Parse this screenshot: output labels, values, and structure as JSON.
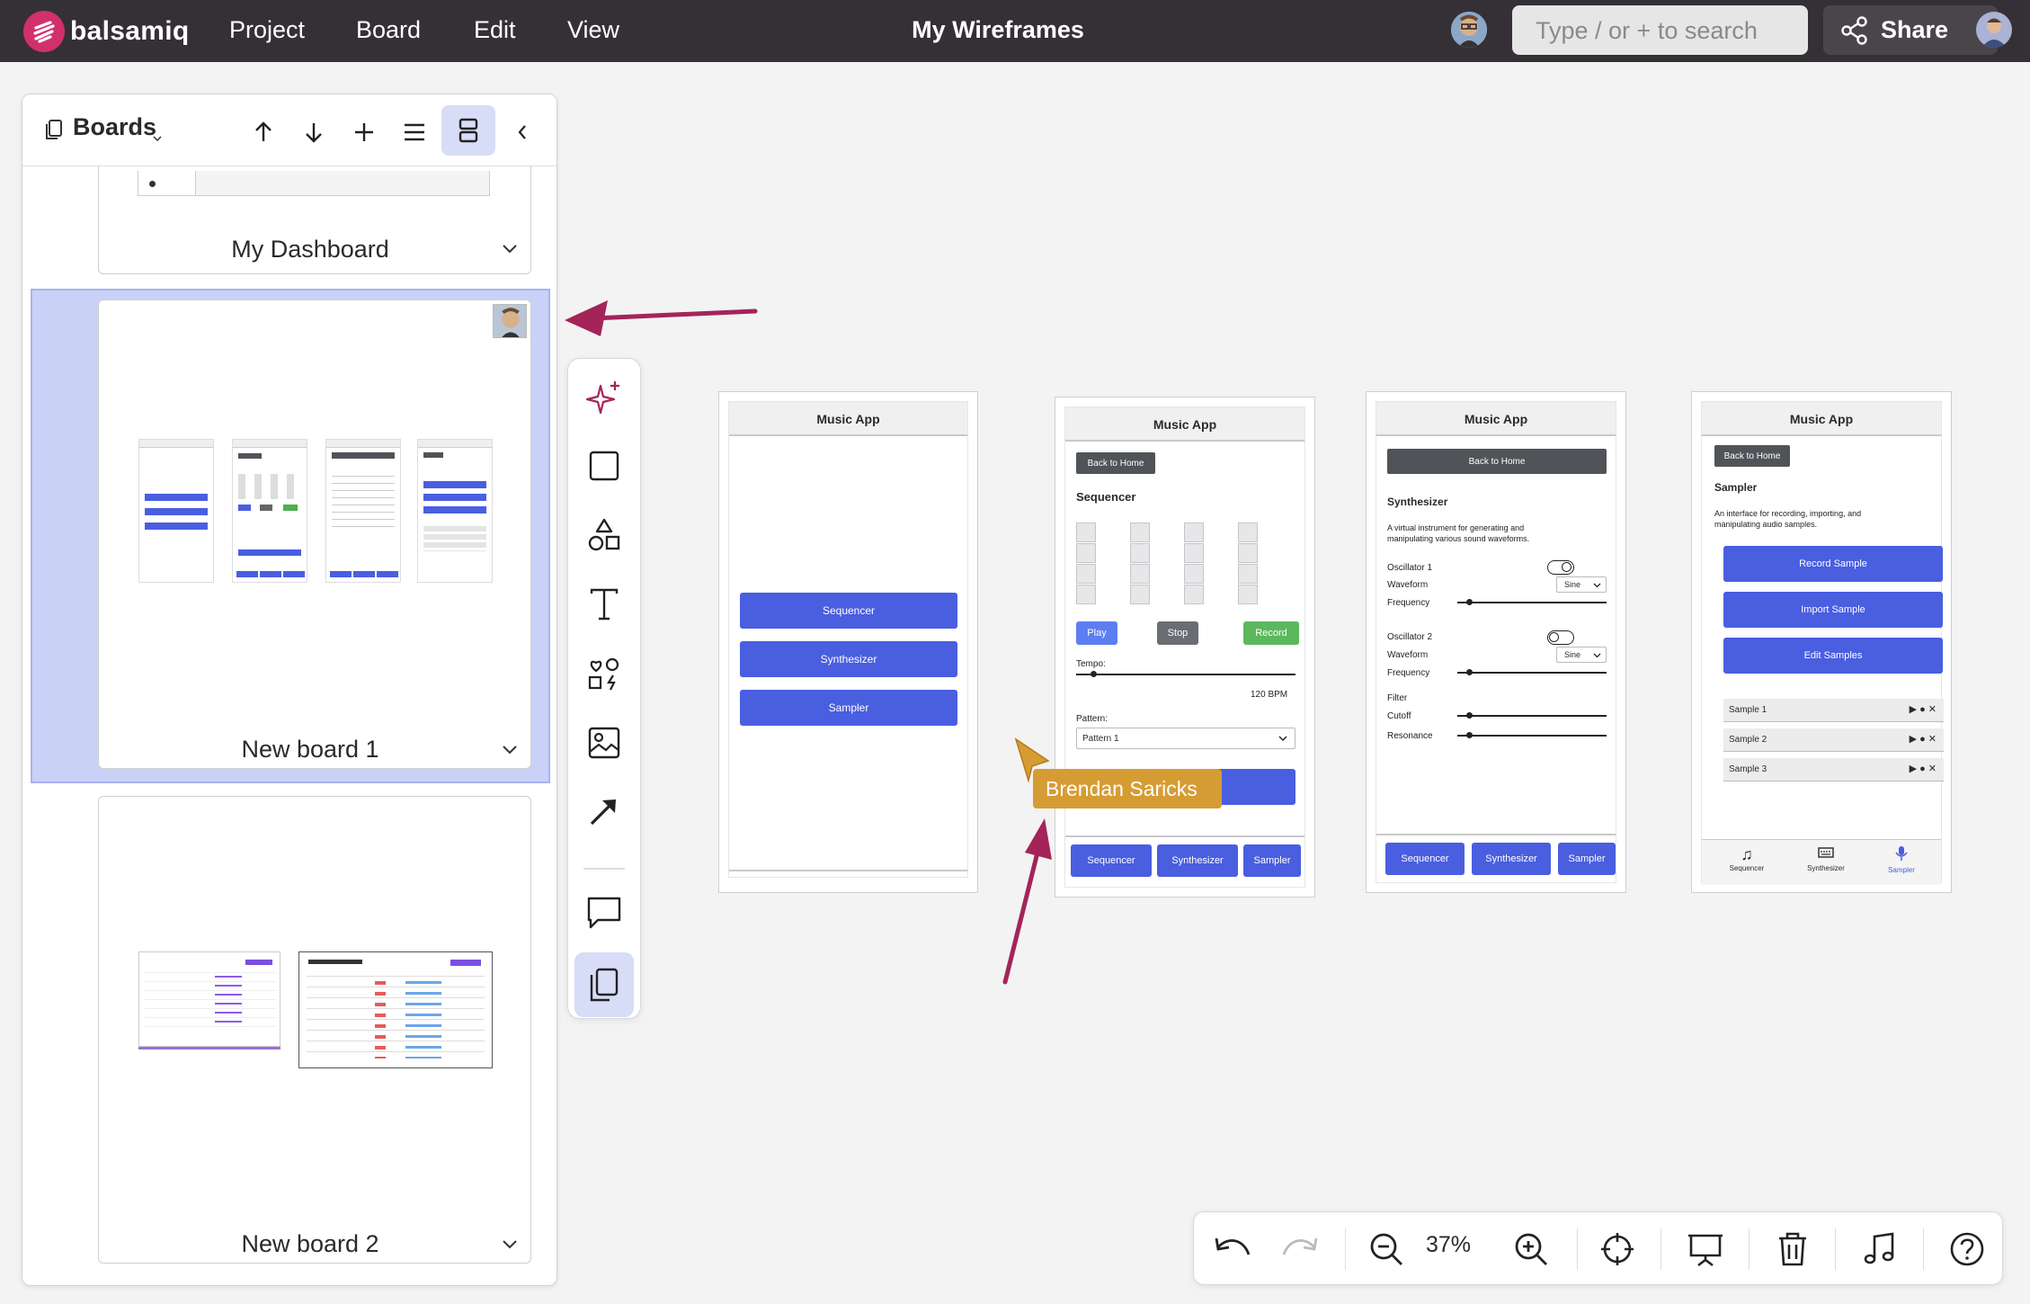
{
  "app": {
    "logo_text": "balsamiq",
    "title": "My Wireframes",
    "menu": [
      "Project",
      "Board",
      "Edit",
      "View"
    ],
    "search_placeholder": "Type / or + to search",
    "share_label": "Share"
  },
  "boards_panel": {
    "title": "Boards",
    "boards": [
      {
        "name": "My Dashboard"
      },
      {
        "name": "New board 1",
        "selected": true
      },
      {
        "name": "New board 2"
      }
    ]
  },
  "toolbar": {
    "tools": [
      "sparkle-icon",
      "rectangle-icon",
      "shapes-icon",
      "text-icon",
      "icons-icon",
      "image-icon",
      "arrow-icon",
      "comment-icon",
      "boards-icon"
    ]
  },
  "wireframes": {
    "home": {
      "title": "Music App",
      "buttons": [
        "Sequencer",
        "Synthesizer",
        "Sampler"
      ]
    },
    "sequencer": {
      "title": "Music App",
      "back": "Back to Home",
      "heading": "Sequencer",
      "play": "Play",
      "stop": "Stop",
      "record": "Record",
      "tempo_label": "Tempo:",
      "tempo_value": "120 BPM",
      "pattern_label": "Pattern:",
      "pattern_value": "Pattern 1",
      "tabs": [
        "Sequencer",
        "Synthesizer",
        "Sampler"
      ]
    },
    "synthesizer": {
      "title": "Music App",
      "back": "Back to Home",
      "heading": "Synthesizer",
      "description": "A virtual instrument for generating and manipulating various sound waveforms.",
      "osc1": "Oscillator 1",
      "osc2": "Oscillator 2",
      "waveform": "Waveform",
      "frequency": "Frequency",
      "sine": "Sine",
      "filter": "Filter",
      "cutoff": "Cutoff",
      "resonance": "Resonance",
      "tabs": [
        "Sequencer",
        "Synthesizer",
        "Sampler"
      ]
    },
    "sampler": {
      "title": "Music App",
      "back": "Back to Home",
      "heading": "Sampler",
      "description": "An interface for recording, importing, and manipulating audio samples.",
      "buttons": [
        "Record Sample",
        "Import Sample",
        "Edit Samples"
      ],
      "samples": [
        "Sample 1",
        "Sample 2",
        "Sample 3"
      ],
      "tabs": [
        "Sequencer",
        "Synthesizer",
        "Sampler"
      ]
    }
  },
  "collaborator": {
    "name": "Brendan Saricks",
    "color": "#d69c34"
  },
  "bottom_bar": {
    "zoom": "37%"
  },
  "colors": {
    "accent": "#4a5ee0",
    "topbar": "#353036",
    "brand": "#d2306c",
    "annotation": "#a4245a"
  }
}
